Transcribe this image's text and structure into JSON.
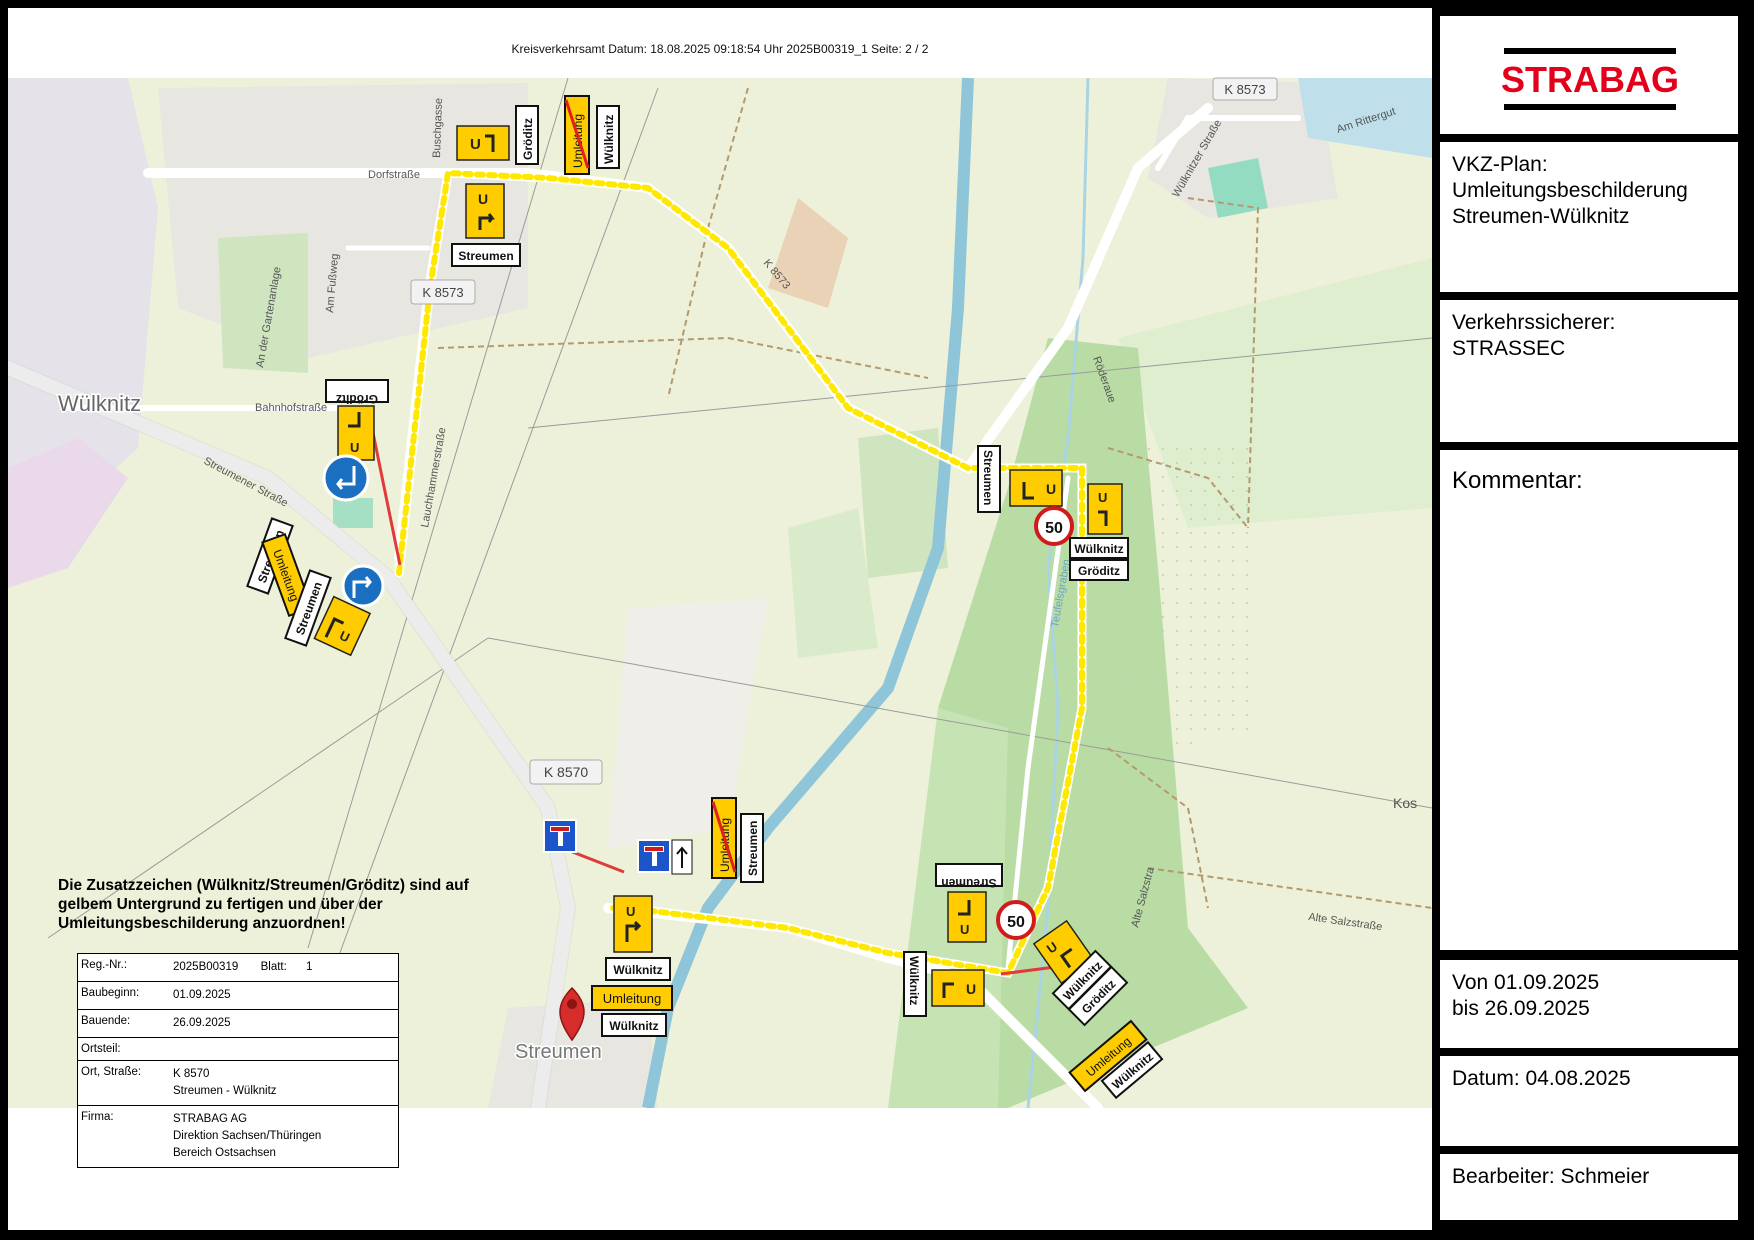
{
  "header": {
    "text": "Kreisverkehrsamt Datum: 18.08.2025 09:18:54 Uhr  2025B00319_1  Seite: 2 / 2"
  },
  "logo": {
    "text": "STRABAG",
    "color": "#e2001a"
  },
  "panel": {
    "plan_title": "VKZ-Plan:\nUmleitungsbeschilderung\nStreumen-Wülknitz",
    "sicherer": "Verkehrssicherer:\nSTRASSEC",
    "kommentar": "Kommentar:",
    "period": "Von 01.09.2025\nbis 26.09.2025",
    "datum": "Datum: 04.08.2025",
    "bearbeiter": "Bearbeiter: Schmeier"
  },
  "note": "Die Zusatzzeichen (Wülknitz/Streumen/Gröditz) sind auf gelbem Untergrund zu fertigen und über der Umleitungsbeschilderung anzuordnen!",
  "info_table": [
    {
      "label": "Reg.-Nr.:",
      "value": "2025B00319       Blatt:      1"
    },
    {
      "label": "Baubeginn:",
      "value": "01.09.2025"
    },
    {
      "label": "Bauende:",
      "value": "26.09.2025"
    },
    {
      "label": "Ortsteil:",
      "value": ""
    },
    {
      "label": "Ort, Straße:",
      "value": "K 8570\nStreumen - Wülknitz"
    },
    {
      "label": "Firma:",
      "value": "STRABAG AG\nDirektion Sachsen/Thüringen\nBereich Ostsachsen"
    }
  ],
  "map": {
    "places": {
      "wuelknitz": "Wülknitz",
      "streumen": "Streumen"
    },
    "roads": {
      "k8573": "K 8573",
      "k8570": "K 8570",
      "k8573_top": "K 8573",
      "dorfstrasse": "Dorfstraße",
      "bahnhofstrasse": "Bahnhofstraße",
      "streumener_strasse": "Streumener Straße",
      "wuelknitzer_strasse": "Wülknitzer Straße",
      "am_rittergut": "Am Rittergut",
      "roederaue": "Röderaue",
      "teufelsgraben": "Teufelsgraben",
      "alte_salzstrasse": "Alte Salzstraße",
      "alte_salzstr_right": "Alte Salzstra",
      "am_fussweg": "Am Fußweg",
      "an_der_gartenanlage": "An der Gartenanlage",
      "buschgasse": "Buschgasse",
      "lauchhammerstr": "Lauchhammerstraße",
      "kos": "Kos",
      "k8573_diag": "K 8573"
    },
    "sign_texts": {
      "groeditz": "Gröditz",
      "wuelknitz": "Wülknitz",
      "streumen": "Streumen",
      "umleitung": "Umleitung",
      "speed": "50",
      "u": "U"
    },
    "colors": {
      "detour": "#ffe800",
      "sign_yellow": "#ffcc00",
      "river": "#8ec5d9",
      "map_bg": "#edf0d6"
    }
  }
}
